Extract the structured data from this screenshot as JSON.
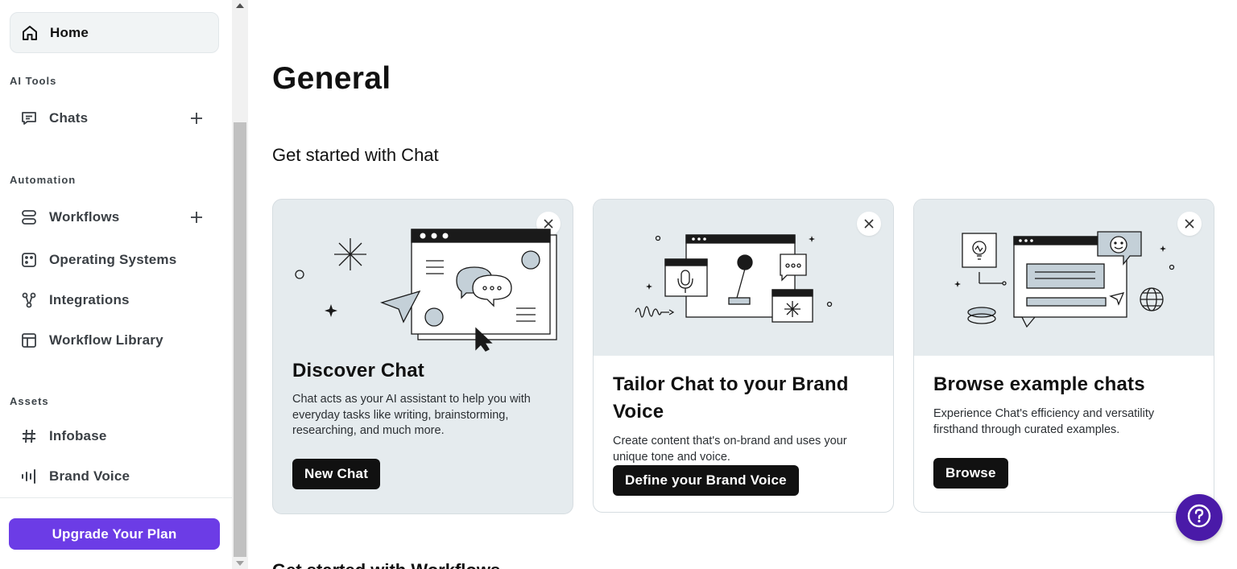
{
  "sidebar": {
    "home_label": "Home",
    "sections": {
      "ai_tools": "AI Tools",
      "automation": "Automation",
      "assets": "Assets"
    },
    "items": {
      "chats": "Chats",
      "workflows": "Workflows",
      "operating_systems": "Operating Systems",
      "integrations": "Integrations",
      "workflow_library": "Workflow Library",
      "infobase": "Infobase",
      "brand_voice": "Brand Voice"
    },
    "upgrade_label": "Upgrade Your Plan",
    "upgrade_color": "#6c3ce6"
  },
  "main": {
    "title": "General",
    "section_chat": "Get started with Chat",
    "section_workflows": "Get started with Workflows",
    "cards": [
      {
        "title": "Discover Chat",
        "description": "Chat acts as your AI assistant to help you with everyday tasks like writing, brainstorming, researching, and much more.",
        "button": "New Chat"
      },
      {
        "title": "Tailor Chat to your Brand Voice",
        "description": "Create content that's on-brand and uses your unique tone and voice.",
        "button": "Define your Brand Voice"
      },
      {
        "title": "Browse example chats",
        "description": "Experience Chat's efficiency and versatility firsthand through curated examples.",
        "button": "Browse"
      }
    ]
  },
  "help": {
    "icon": "question-icon",
    "color": "#4a1aa8"
  }
}
